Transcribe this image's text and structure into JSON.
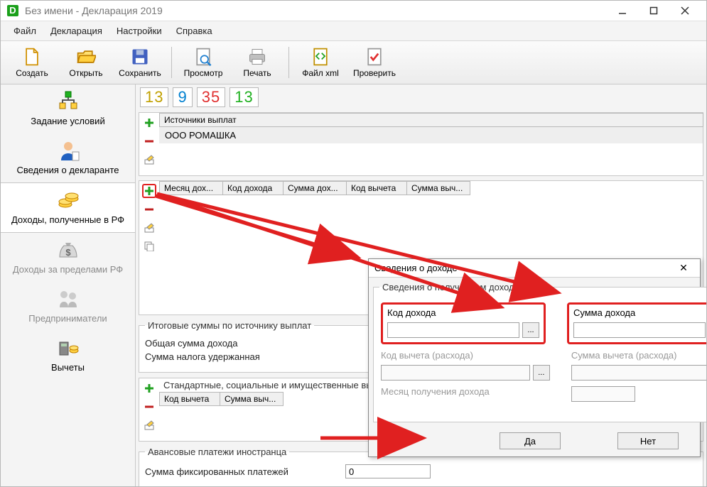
{
  "title": "Без имени - Декларация 2019",
  "menus": {
    "file": "Файл",
    "decl": "Декларация",
    "settings": "Настройки",
    "help": "Справка"
  },
  "toolbar": {
    "create": "Создать",
    "open": "Открыть",
    "save": "Сохранить",
    "preview": "Просмотр",
    "print": "Печать",
    "xml": "Файл xml",
    "check": "Проверить"
  },
  "sidebar": {
    "conditions": "Задание условий",
    "declarant": "Сведения о декларанте",
    "income_rf": "Доходы, полученные в РФ",
    "income_abroad": "Доходы за пределами РФ",
    "entrepreneur": "Предприниматели",
    "deductions": "Вычеты"
  },
  "rates": {
    "r13a": "13",
    "r9": "9",
    "r35": "35",
    "r13b": "13"
  },
  "sources": {
    "header": "Источники выплат",
    "row1": "ООО РОМАШКА"
  },
  "cols": {
    "month": "Месяц дох...",
    "code": "Код дохода",
    "sum": "Сумма дох...",
    "ded_code": "Код вычета",
    "ded_sum": "Сумма выч..."
  },
  "totals": {
    "legend": "Итоговые суммы по источнику выплат",
    "total_income": "Общая сумма дохода",
    "tax_withheld": "Сумма налога удержанная"
  },
  "deduct": {
    "legend": "Стандартные, социальные и имущественные выч",
    "code": "Код вычета",
    "sum": "Сумма выч..."
  },
  "advance": {
    "legend": "Авансовые платежи иностранца",
    "fixed": "Сумма фиксированных платежей",
    "value": "0"
  },
  "dialog": {
    "title": "Сведения о доходе",
    "group": "Сведения о полученном доходе",
    "code_label": "Код дохода",
    "sum_label": "Сумма дохода",
    "ded_code_label": "Код вычета (расхода)",
    "ded_sum_label": "Сумма вычета (расхода)",
    "month_label": "Месяц получения дохода",
    "ok": "Да",
    "cancel": "Нет"
  }
}
